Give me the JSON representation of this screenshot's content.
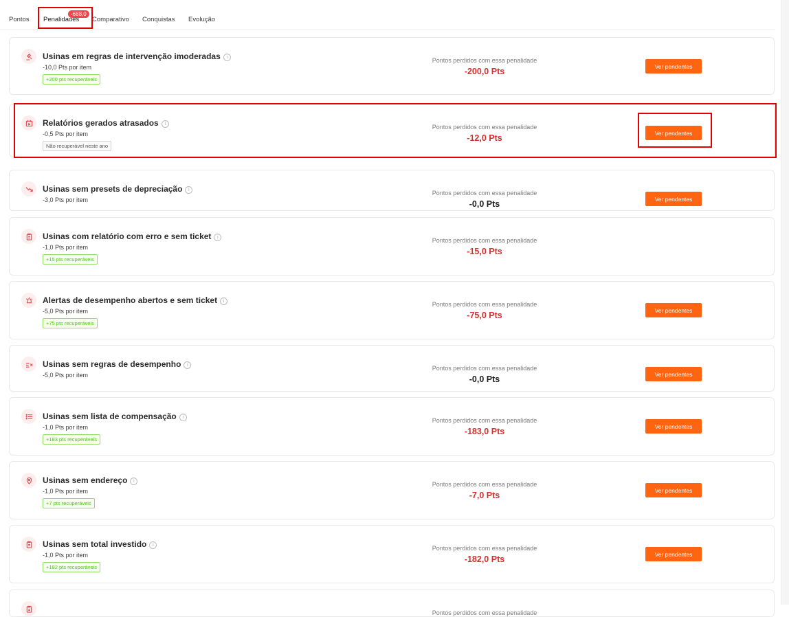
{
  "tabs": [
    {
      "label": "Pontos",
      "active": false
    },
    {
      "label": "Penalidades",
      "active": true,
      "badge": "-688,0"
    },
    {
      "label": "Comparativo",
      "active": false
    },
    {
      "label": "Conquistas",
      "active": false
    },
    {
      "label": "Evolução",
      "active": false
    }
  ],
  "accent_color": "#ff6410",
  "loss_label": "Pontos perdidos com essa penalidade",
  "button_label": "Ver pendentes",
  "penalties": [
    {
      "icon": "gavel-icon",
      "title": "Usinas em regras de intervenção imoderadas",
      "per_item": "-10,0 Pts por item",
      "tag": "+200 pts recuperáveis",
      "tag_type": "green",
      "points": "-200,0 Pts",
      "value_color": "red",
      "has_button": true
    },
    {
      "icon": "calendar-x-icon",
      "title": "Relatórios gerados atrasados",
      "per_item": "-0,5 Pts por item",
      "tag": "Não recuperável neste ano",
      "tag_type": "gray",
      "points": "-12,0 Pts",
      "value_color": "red",
      "has_button": true
    },
    {
      "icon": "trend-down-icon",
      "title": "Usinas sem presets de depreciação",
      "per_item": "-3,0 Pts por item",
      "tag": "",
      "tag_type": "none",
      "points": "-0,0 Pts",
      "value_color": "dark",
      "has_button": true
    },
    {
      "icon": "clipboard-icon",
      "title": "Usinas com relatório com erro e sem ticket",
      "per_item": "-1,0 Pts por item",
      "tag": "+15 pts recuperáveis",
      "tag_type": "green",
      "points": "-15,0 Pts",
      "value_color": "red",
      "has_button": false
    },
    {
      "icon": "alarm-icon",
      "title": "Alertas de desempenho abertos e sem ticket",
      "per_item": "-5,0 Pts por item",
      "tag": "+75 pts recuperáveis",
      "tag_type": "green",
      "points": "-75,0 Pts",
      "value_color": "red",
      "has_button": true
    },
    {
      "icon": "list-x-icon",
      "title": "Usinas sem regras de desempenho",
      "per_item": "-5,0 Pts por item",
      "tag": "",
      "tag_type": "none",
      "points": "-0,0 Pts",
      "value_color": "dark",
      "has_button": true
    },
    {
      "icon": "list-icon",
      "title": "Usinas sem lista de compensação",
      "per_item": "-1,0 Pts por item",
      "tag": "+183 pts recuperáveis",
      "tag_type": "green",
      "points": "-183,0 Pts",
      "value_color": "red",
      "has_button": true
    },
    {
      "icon": "map-pin-icon",
      "title": "Usinas sem endereço",
      "per_item": "-1,0 Pts por item",
      "tag": "+7 pts recuperáveis",
      "tag_type": "green",
      "points": "-7,0 Pts",
      "value_color": "red",
      "has_button": true
    },
    {
      "icon": "clipboard-icon",
      "title": "Usinas sem total investido",
      "per_item": "-1,0 Pts por item",
      "tag": "+182 pts recuperáveis",
      "tag_type": "green",
      "points": "-182,0 Pts",
      "value_color": "red",
      "has_button": true
    },
    {
      "icon": "clipboard-icon",
      "title": "",
      "per_item": "",
      "tag": "",
      "tag_type": "none",
      "points": "",
      "value_color": "red",
      "has_button": false
    }
  ]
}
